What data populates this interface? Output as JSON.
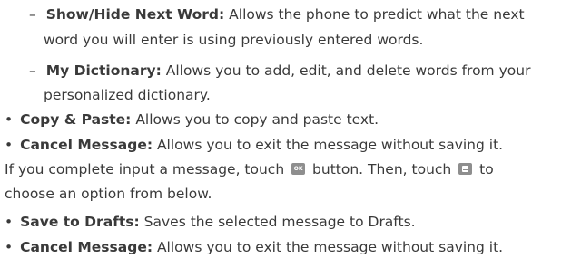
{
  "sub_items": [
    {
      "marker": "–",
      "title": "Show/Hide Next Word:",
      "line1": " Allows the phone to predict what the next",
      "line2": "word you will enter is using previously entered words."
    },
    {
      "marker": "–",
      "title": "My Dictionary:",
      "line1": " Allows you to add, edit, and delete words from your",
      "line2": "personalized dictionary."
    }
  ],
  "bullets_top": [
    {
      "marker": "•",
      "title": "Copy & Paste:",
      "text": " Allows you to copy and paste text."
    },
    {
      "marker": "•",
      "title": "Cancel Message:",
      "text": " Allows you to exit the message without saving it."
    }
  ],
  "paragraph": {
    "part1": "If you complete input a message, touch",
    "ok_icon_label": "OK",
    "part2": "button. Then, touch",
    "part3": "to",
    "line2": "choose an option from below."
  },
  "bullets_bottom": [
    {
      "marker": "•",
      "title": "Save to Drafts:",
      "text": " Saves the selected message to Drafts."
    },
    {
      "marker": "•",
      "title": "Cancel Message:",
      "text": " Allows you to exit the message without saving it."
    }
  ],
  "icons": {
    "ok_button": "ok-key-icon",
    "menu_button": "menu-key-icon"
  }
}
